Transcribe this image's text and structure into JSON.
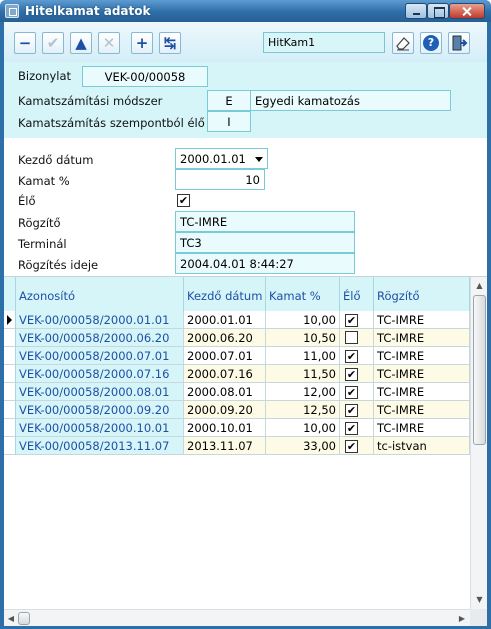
{
  "window": {
    "title": "Hitelkamat adatok"
  },
  "toolbar": {
    "search_value": "HitKam1",
    "buttons": [
      {
        "name": "delete-button",
        "icon": "minus-icon",
        "glyph": "−"
      },
      {
        "name": "confirm-button",
        "icon": "check-icon",
        "glyph": "✔"
      },
      {
        "name": "up-button",
        "icon": "triangle-up-icon",
        "glyph": "▲"
      },
      {
        "name": "cancel-button",
        "icon": "x-icon",
        "glyph": "✕"
      },
      {
        "name": "add-button",
        "icon": "plus-icon",
        "glyph": "+"
      },
      {
        "name": "split-button",
        "icon": "split-arrows-icon",
        "glyph": "↹"
      }
    ]
  },
  "header": {
    "bizonylat_label": "Bizonylat",
    "bizonylat_value": "VEK-00/00058",
    "method_label": "Kamatszámítási módszer",
    "method_code": "E",
    "method_name": "Egyedi kamatozás",
    "live_label": "Kamatszámítás szempontból élő",
    "live_value": "I"
  },
  "fields": {
    "start_date_label": "Kezdő dátum",
    "start_date_value": "2000.01.01",
    "rate_label": "Kamat %",
    "rate_value": "10",
    "live_label": "Élő",
    "live_checked": "✔",
    "recorder_label": "Rögzítő",
    "recorder_value": "TC-IMRE",
    "terminal_label": "Terminál",
    "terminal_value": "TC3",
    "recorded_at_label": "Rögzítés ideje",
    "recorded_at_value": "2004.04.01 8:44:27"
  },
  "grid": {
    "columns": [
      "Azonosító",
      "Kezdő dátum",
      "Kamat %",
      "Élő",
      "Rögzítő"
    ],
    "rows": [
      {
        "id": "VEK-00/00058/2000.01.01",
        "date": "2000.01.01",
        "rate": "10,00",
        "live": "✔",
        "recorder": "TC-IMRE"
      },
      {
        "id": "VEK-00/00058/2000.06.20",
        "date": "2000.06.20",
        "rate": "10,50",
        "live": "",
        "recorder": "TC-IMRE"
      },
      {
        "id": "VEK-00/00058/2000.07.01",
        "date": "2000.07.01",
        "rate": "11,00",
        "live": "✔",
        "recorder": "TC-IMRE"
      },
      {
        "id": "VEK-00/00058/2000.07.16",
        "date": "2000.07.16",
        "rate": "11,50",
        "live": "✔",
        "recorder": "TC-IMRE"
      },
      {
        "id": "VEK-00/00058/2000.08.01",
        "date": "2000.08.01",
        "rate": "12,00",
        "live": "✔",
        "recorder": "TC-IMRE"
      },
      {
        "id": "VEK-00/00058/2000.09.20",
        "date": "2000.09.20",
        "rate": "12,50",
        "live": "✔",
        "recorder": "TC-IMRE"
      },
      {
        "id": "VEK-00/00058/2000.10.01",
        "date": "2000.10.01",
        "rate": "10,00",
        "live": "✔",
        "recorder": "TC-IMRE"
      },
      {
        "id": "VEK-00/00058/2013.11.07",
        "date": "2013.11.07",
        "rate": "33,00",
        "live": "✔",
        "recorder": "tc-istvan"
      }
    ]
  }
}
